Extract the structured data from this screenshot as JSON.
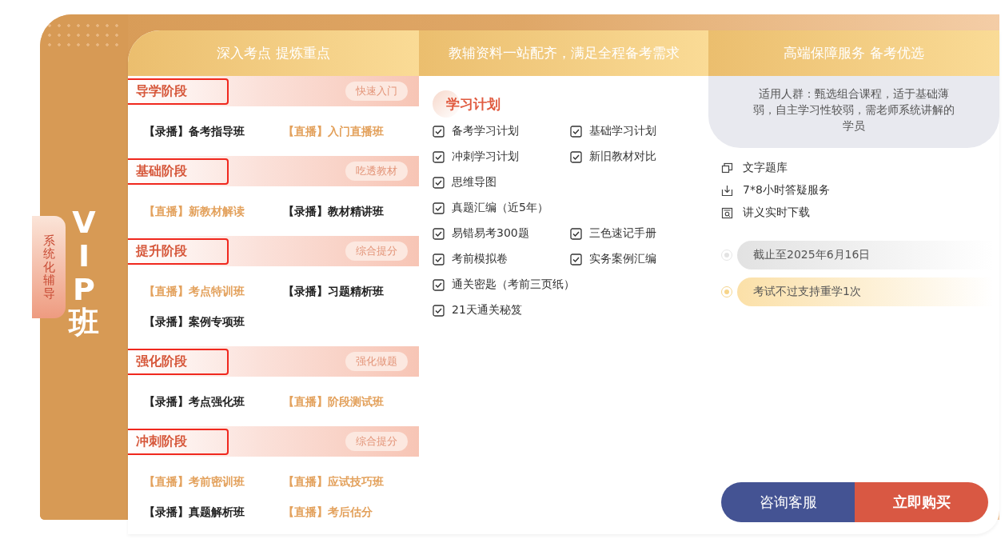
{
  "side_tab": {
    "label": "系统化辅导"
  },
  "plan_name": "VIP班",
  "columns": [
    {
      "title": "深入考点 提炼重点"
    },
    {
      "title": "教辅资料一站配齐，满足全程备考需求"
    },
    {
      "title": "高端保障服务 备考优选"
    }
  ],
  "stages": [
    {
      "title": "导学阶段",
      "highlighted": true,
      "tag": "快速入门",
      "courses": [
        {
          "label": "【录播】备考指导班",
          "kind": "recorded"
        },
        {
          "label": "【直播】入门直播班",
          "kind": "live"
        }
      ]
    },
    {
      "title": "基础阶段",
      "highlighted": true,
      "tag": "吃透教材",
      "courses": [
        {
          "label": "【直播】新教材解读",
          "kind": "live"
        },
        {
          "label": "【录播】教材精讲班",
          "kind": "recorded"
        }
      ]
    },
    {
      "title": "提升阶段",
      "highlighted": true,
      "tag": "综合提分",
      "courses": [
        {
          "label": "【直播】考点特训班",
          "kind": "live"
        },
        {
          "label": "【录播】习题精析班",
          "kind": "recorded"
        },
        {
          "label": "【录播】案例专项班",
          "kind": "recorded"
        }
      ]
    },
    {
      "title": "强化阶段",
      "highlighted": true,
      "tag": "强化做题",
      "courses": [
        {
          "label": "【录播】考点强化班",
          "kind": "recorded"
        },
        {
          "label": "【直播】阶段测试班",
          "kind": "live"
        }
      ]
    },
    {
      "title": "冲刺阶段",
      "highlighted": true,
      "tag": "综合提分",
      "courses": [
        {
          "label": "【直播】考前密训班",
          "kind": "live"
        },
        {
          "label": "【直播】应试技巧班",
          "kind": "live"
        },
        {
          "label": "【录播】真题解析班",
          "kind": "recorded"
        },
        {
          "label": "【直播】考后估分",
          "kind": "live"
        }
      ]
    }
  ],
  "study_plan": {
    "title": "学习计划",
    "rows": [
      [
        {
          "label": "备考学习计划",
          "checked": true
        },
        {
          "label": "基础学习计划",
          "checked": true
        }
      ],
      [
        {
          "label": "冲刺学习计划",
          "checked": true
        },
        {
          "label": "新旧教材对比",
          "checked": true
        }
      ],
      [
        {
          "label": "思维导图",
          "checked": true
        }
      ],
      [
        {
          "label": "真题汇编（近5年）",
          "checked": true
        }
      ],
      [
        {
          "label": "易错易考300题",
          "checked": true
        },
        {
          "label": "三色速记手册",
          "checked": true
        }
      ],
      [
        {
          "label": "考前模拟卷",
          "checked": true
        },
        {
          "label": "实务案例汇编",
          "checked": true
        }
      ],
      [
        {
          "label": "通关密匙（考前三页纸）",
          "checked": true
        }
      ],
      [
        {
          "label": "21天通关秘笈",
          "checked": true
        }
      ]
    ]
  },
  "audience": "适用人群：甄选组合课程，适于基础薄弱，自主学习性较弱，需老师系统讲解的学员",
  "services": [
    "文字题库",
    "7*8小时答疑服务",
    "讲义实时下载"
  ],
  "highlights": [
    {
      "label": "截止至2025年6月16日",
      "kind": "plain"
    },
    {
      "label": "考试不过支持重学1次",
      "kind": "gold"
    }
  ],
  "buttons": [
    {
      "label": "咨询客服",
      "kind": "secondary"
    },
    {
      "label": "立即购买",
      "kind": "primary"
    }
  ]
}
